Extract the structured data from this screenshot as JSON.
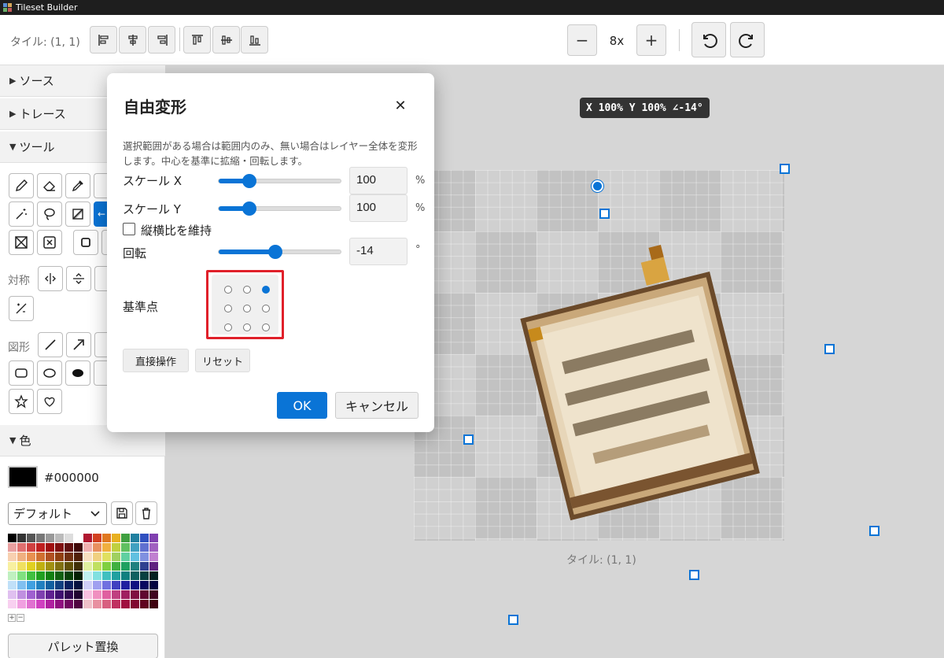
{
  "window": {
    "title": "Tileset Builder"
  },
  "toolbar": {
    "tile_label": "タイル: (1, 1)",
    "align_icons": [
      "align-left-icon",
      "align-center-horizontal-icon",
      "align-right-icon",
      "align-top-icon",
      "align-middle-vertical-icon",
      "align-bottom-icon"
    ],
    "zoom_out": "−",
    "zoom_level": "8x",
    "zoom_in": "+",
    "undo_icon": "undo-icon",
    "redo_icon": "redo-icon"
  },
  "sidebar": {
    "sections": {
      "source": "ソース",
      "trace": "トレース",
      "tools": "ツール",
      "color": "色"
    },
    "symmetry_label": "対称",
    "shapes_label": "図形",
    "color": {
      "hex": "#000000",
      "current": "#000000",
      "preset": "デフォルト",
      "palette_button": "パレット置換"
    }
  },
  "canvas": {
    "transform_tooltip": "X 100% Y 100% ∠-14°",
    "tile_caption": "タイル: (1, 1)"
  },
  "dialog": {
    "title": "自由変形",
    "close": "✕",
    "description": "選択範囲がある場合は範囲内のみ、無い場合はレイヤー全体を変形します。中心を基準に拡縮・回転します。",
    "scale_x": {
      "label": "スケール X",
      "value": "100",
      "unit": "%",
      "level": 0.25
    },
    "scale_y": {
      "label": "スケール Y",
      "value": "100",
      "unit": "%",
      "level": 0.25
    },
    "keep_aspect": {
      "label": "縦横比を維持",
      "checked": false
    },
    "rotation": {
      "label": "回転",
      "value": "-14",
      "unit": "°",
      "level": 0.46
    },
    "anchor": {
      "label": "基準点",
      "selected": "top-right"
    },
    "direct_button": "直接操作",
    "reset_button": "リセット",
    "ok_button": "OK",
    "cancel_button": "キャンセル"
  },
  "colors": {
    "accent": "#0a74d6",
    "highlight": "#e0202a"
  }
}
